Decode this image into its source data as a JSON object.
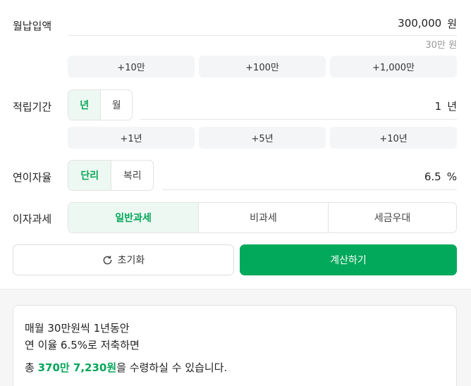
{
  "monthly": {
    "label": "월납입액",
    "value": "300,000",
    "unit": "원",
    "hint": "30만 원",
    "quick": [
      "+10만",
      "+100만",
      "+1,000만"
    ]
  },
  "period": {
    "label": "적립기간",
    "options": [
      "년",
      "월"
    ],
    "selected": "년",
    "value": "1",
    "unit": "년",
    "quick": [
      "+1년",
      "+5년",
      "+10년"
    ]
  },
  "rate": {
    "label": "연이자율",
    "options": [
      "단리",
      "복리"
    ],
    "selected": "단리",
    "value": "6.5",
    "unit": "%"
  },
  "tax": {
    "label": "이자과세",
    "options": [
      "일반과세",
      "비과세",
      "세금우대"
    ],
    "selected": "일반과세"
  },
  "actions": {
    "reset_label": "초기화",
    "calc_label": "계산하기"
  },
  "result": {
    "line1": "매월 30만원씩 1년동안",
    "line2": "연 이율 6.5%로 저축하면",
    "total_prefix": "총 ",
    "total_amount": "370만 7,230원",
    "total_suffix": "을 수령하실 수 있습니다."
  },
  "colors": {
    "accent": "#03a95b",
    "accent_bg": "#eef8f2"
  }
}
